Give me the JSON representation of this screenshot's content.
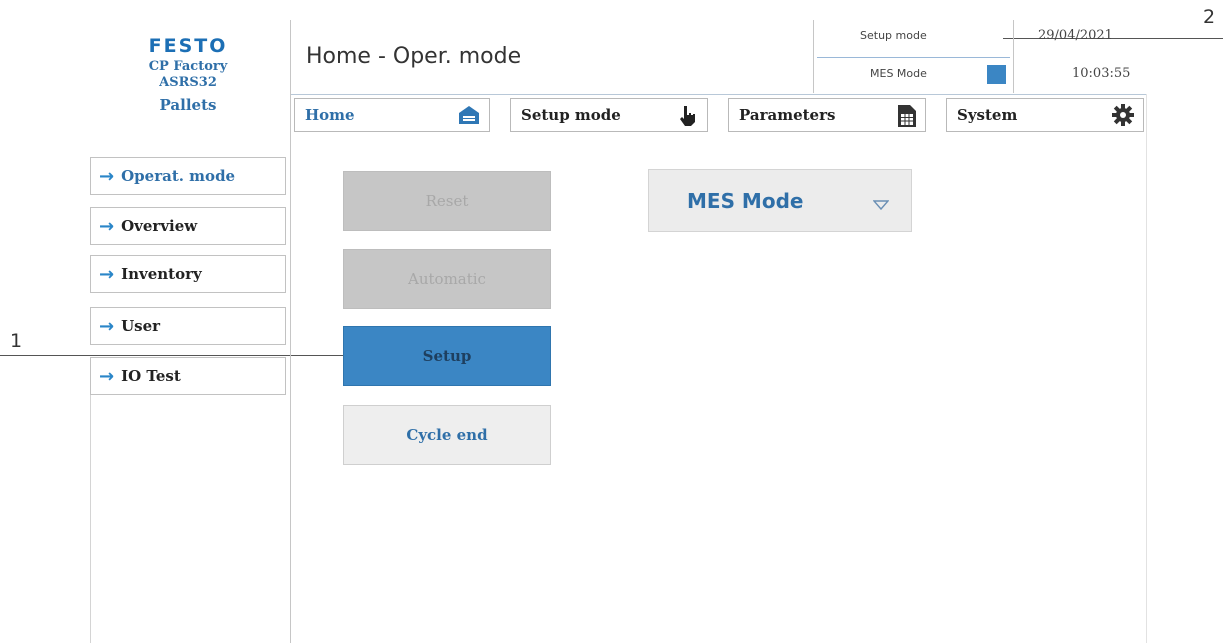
{
  "brand": {
    "logo": "FESTO",
    "line1": "CP Factory",
    "line2": "ASRS32",
    "line3": "Pallets"
  },
  "header": {
    "title": "Home - Oper. mode",
    "status_label": "Setup mode",
    "date": "29/04/2021",
    "mode_label": "MES Mode",
    "time": "10:03:55",
    "mode_indicator_color": "#3b86c4"
  },
  "tabs": [
    {
      "label": "Home",
      "icon": "home-icon"
    },
    {
      "label": "Setup mode",
      "icon": "hand-pointer-icon"
    },
    {
      "label": "Parameters",
      "icon": "document-table-icon"
    },
    {
      "label": "System",
      "icon": "gear-icon"
    }
  ],
  "sidebar": {
    "items": [
      {
        "label": "Operat. mode"
      },
      {
        "label": "Overview"
      },
      {
        "label": "Inventory"
      },
      {
        "label": "User"
      },
      {
        "label": "IO Test"
      }
    ]
  },
  "mode_buttons": {
    "reset": "Reset",
    "automatic": "Automatic",
    "setup": "Setup",
    "cycle_end": "Cycle end"
  },
  "mes_select": {
    "value": "MES Mode"
  },
  "callouts": {
    "one": "1",
    "two": "2"
  },
  "colors": {
    "accent": "#3b86c4",
    "text_blue": "#2f6fa8"
  }
}
